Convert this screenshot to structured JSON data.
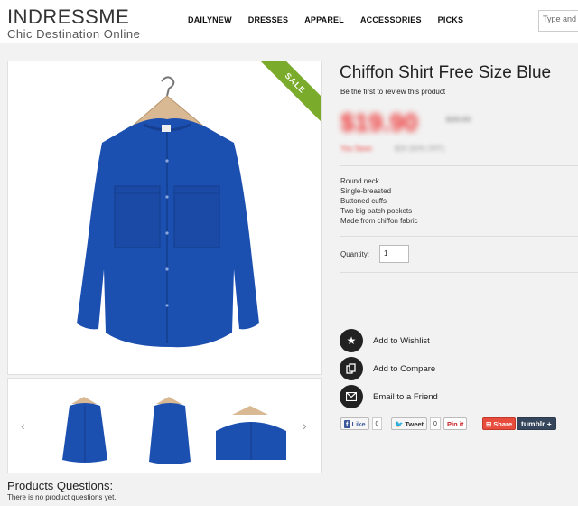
{
  "header": {
    "logo_main": "INDRESSME",
    "logo_sub": "Chic Destination Online",
    "nav": [
      "DAILYNEW",
      "DRESSES",
      "APPAREL",
      "ACCESSORIES",
      "PICKS"
    ],
    "search_placeholder": "Type and h"
  },
  "product": {
    "sale_badge": "SALE",
    "title": "Chiffon Shirt Free Size Blue",
    "review_text": "Be the first to review this product",
    "price": "$19.90",
    "old_price": "$39.90",
    "save_label": "You Save:",
    "save_value": "$20 (50% OFF)",
    "features": [
      "Round neck",
      "Single-breasted",
      "Buttoned cuffs",
      "Two big patch pockets",
      "Made from chiffon fabric"
    ],
    "qty_label": "Quantity:",
    "qty_value": "1",
    "main_color": "#1b4fb0"
  },
  "actions": {
    "wishlist": "Add to Wishlist",
    "compare": "Add to Compare",
    "email": "Email to a Friend"
  },
  "thumbs": {
    "prev": "‹",
    "next": "›"
  },
  "share": {
    "like_label": "Like",
    "like_count": "0",
    "tweet_label": "Tweet",
    "tweet_count": "0",
    "pin_label": "Pin it",
    "share_label": "Share",
    "tumblr_label": "tumblr +"
  },
  "questions": {
    "title": "Products Questions:",
    "text": "There is no product questions yet."
  }
}
